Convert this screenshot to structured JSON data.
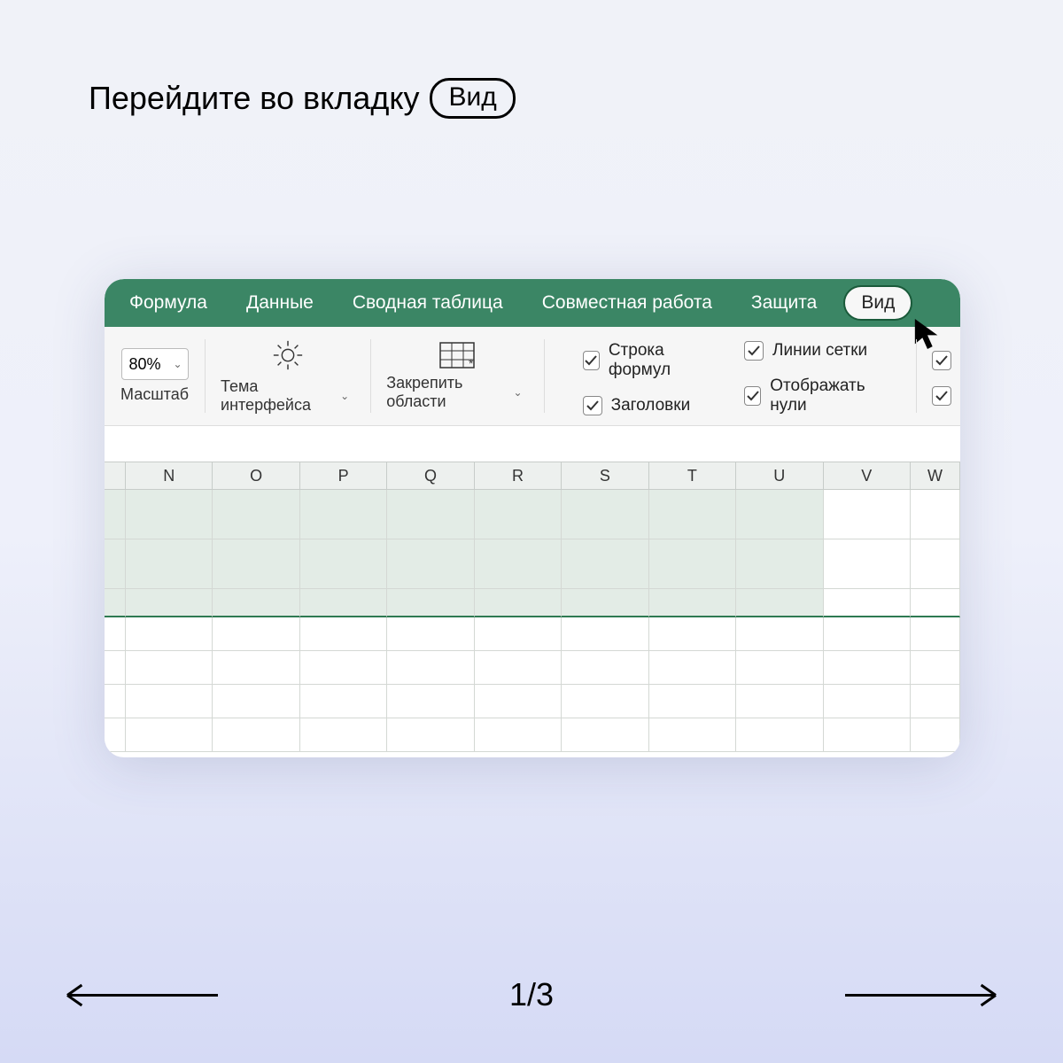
{
  "instruction": {
    "prefix": "Перейдите во вкладку",
    "pill": "Вид"
  },
  "tabs": {
    "items": [
      "Формула",
      "Данные",
      "Сводная таблица",
      "Совместная работа",
      "Защита"
    ],
    "active": "Вид"
  },
  "ribbon": {
    "zoom": {
      "value": "80%",
      "label": "Масштаб"
    },
    "theme": {
      "label": "Тема интерфейса"
    },
    "freeze": {
      "label": "Закрепить области"
    },
    "checks": {
      "formula_bar": "Строка формул",
      "headings": "Заголовки",
      "gridlines": "Линии сетки",
      "show_zeros": "Отображать нули"
    }
  },
  "columns": [
    "N",
    "O",
    "P",
    "Q",
    "R",
    "S",
    "T",
    "U",
    "V",
    "W"
  ],
  "pager": {
    "label": "1/3"
  },
  "colors": {
    "accent": "#3b8665"
  }
}
